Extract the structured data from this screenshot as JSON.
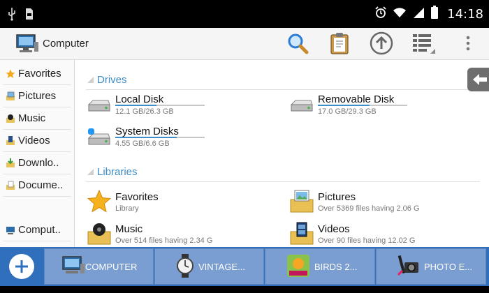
{
  "status_bar": {
    "time": "14:18",
    "icons": [
      "usb-icon",
      "sd-card-icon",
      "alarm-icon",
      "wifi-icon",
      "signal-icon",
      "battery-icon"
    ]
  },
  "action_bar": {
    "title": "Computer",
    "buttons": [
      "search-icon",
      "clipboard-icon",
      "up-icon",
      "view-mode-icon",
      "overflow-icon"
    ]
  },
  "sidebar": {
    "items": [
      {
        "label": "Favorites",
        "icon": "star-icon"
      },
      {
        "label": "Pictures",
        "icon": "pictures-icon"
      },
      {
        "label": "Music",
        "icon": "music-icon"
      },
      {
        "label": "Videos",
        "icon": "videos-icon"
      },
      {
        "label": "Downlo..",
        "icon": "downloads-icon"
      },
      {
        "label": "Docume..",
        "icon": "documents-icon"
      },
      {
        "label": "Comput..",
        "icon": "computer-icon"
      }
    ]
  },
  "drives": {
    "heading": "Drives",
    "items": [
      {
        "name": "Local Disk",
        "sub": "12.1 GB/26.3 GB",
        "used_fraction": 0.46
      },
      {
        "name": "Removable Disk",
        "sub": "17.0 GB/29.3 GB",
        "used_fraction": 0.58
      },
      {
        "name": "System Disks",
        "sub": "4.55 GB/6.6 GB",
        "used_fraction": 0.69
      }
    ]
  },
  "libraries": {
    "heading": "Libraries",
    "items": [
      {
        "name": "Favorites",
        "sub": "Library"
      },
      {
        "name": "Pictures",
        "sub": "Over 5369 files having 2.06 G"
      },
      {
        "name": "Music",
        "sub": "Over 514 files having 2.34 G"
      },
      {
        "name": "Videos",
        "sub": "Over 90 files having 12.02 G"
      }
    ]
  },
  "bottom_tabs": [
    {
      "label": "COMPUTER",
      "icon": "computer-icon"
    },
    {
      "label": "VINTAGE...",
      "icon": "watch-icon"
    },
    {
      "label": "BIRDS 2...",
      "icon": "birds-icon"
    },
    {
      "label": "PHOTO E...",
      "icon": "photo-editor-icon"
    }
  ],
  "colors": {
    "accent": "#3d8ec9",
    "bottom_bar": "#2f6fbc",
    "tab": "#7a9ed1"
  }
}
